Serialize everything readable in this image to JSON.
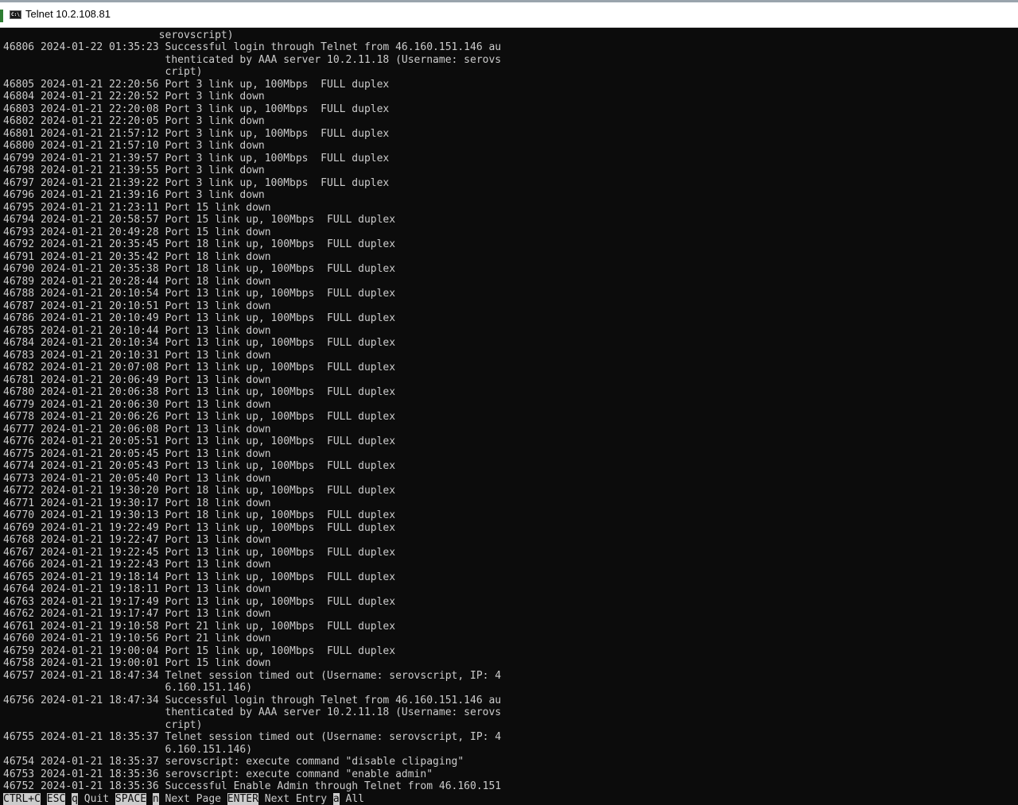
{
  "window": {
    "title": "Telnet 10.2.108.81",
    "icon": "console-icon",
    "icon_text": "C:\\"
  },
  "colors": {
    "terminal_bg": "#0c0c0c",
    "terminal_fg": "#cccccc",
    "titlebar_bg": "#ffffff"
  },
  "terminal": {
    "lines": [
      "                         serovscript)",
      "46806 2024-01-22 01:35:23 Successful login through Telnet from 46.160.151.146 au",
      "                          thenticated by AAA server 10.2.11.18 (Username: serovs",
      "                          cript)",
      "46805 2024-01-21 22:20:56 Port 3 link up, 100Mbps  FULL duplex",
      "46804 2024-01-21 22:20:52 Port 3 link down",
      "46803 2024-01-21 22:20:08 Port 3 link up, 100Mbps  FULL duplex",
      "46802 2024-01-21 22:20:05 Port 3 link down",
      "46801 2024-01-21 21:57:12 Port 3 link up, 100Mbps  FULL duplex",
      "46800 2024-01-21 21:57:10 Port 3 link down",
      "46799 2024-01-21 21:39:57 Port 3 link up, 100Mbps  FULL duplex",
      "46798 2024-01-21 21:39:55 Port 3 link down",
      "46797 2024-01-21 21:39:22 Port 3 link up, 100Mbps  FULL duplex",
      "46796 2024-01-21 21:39:16 Port 3 link down",
      "46795 2024-01-21 21:23:11 Port 15 link down",
      "46794 2024-01-21 20:58:57 Port 15 link up, 100Mbps  FULL duplex",
      "46793 2024-01-21 20:49:28 Port 15 link down",
      "46792 2024-01-21 20:35:45 Port 18 link up, 100Mbps  FULL duplex",
      "46791 2024-01-21 20:35:42 Port 18 link down",
      "46790 2024-01-21 20:35:38 Port 18 link up, 100Mbps  FULL duplex",
      "46789 2024-01-21 20:28:44 Port 18 link down",
      "46788 2024-01-21 20:10:54 Port 13 link up, 100Mbps  FULL duplex",
      "46787 2024-01-21 20:10:51 Port 13 link down",
      "46786 2024-01-21 20:10:49 Port 13 link up, 100Mbps  FULL duplex",
      "46785 2024-01-21 20:10:44 Port 13 link down",
      "46784 2024-01-21 20:10:34 Port 13 link up, 100Mbps  FULL duplex",
      "46783 2024-01-21 20:10:31 Port 13 link down",
      "46782 2024-01-21 20:07:08 Port 13 link up, 100Mbps  FULL duplex",
      "46781 2024-01-21 20:06:49 Port 13 link down",
      "46780 2024-01-21 20:06:38 Port 13 link up, 100Mbps  FULL duplex",
      "46779 2024-01-21 20:06:30 Port 13 link down",
      "46778 2024-01-21 20:06:26 Port 13 link up, 100Mbps  FULL duplex",
      "46777 2024-01-21 20:06:08 Port 13 link down",
      "46776 2024-01-21 20:05:51 Port 13 link up, 100Mbps  FULL duplex",
      "46775 2024-01-21 20:05:45 Port 13 link down",
      "46774 2024-01-21 20:05:43 Port 13 link up, 100Mbps  FULL duplex",
      "46773 2024-01-21 20:05:40 Port 13 link down",
      "46772 2024-01-21 19:30:20 Port 18 link up, 100Mbps  FULL duplex",
      "46771 2024-01-21 19:30:17 Port 18 link down",
      "46770 2024-01-21 19:30:13 Port 18 link up, 100Mbps  FULL duplex",
      "46769 2024-01-21 19:22:49 Port 13 link up, 100Mbps  FULL duplex",
      "46768 2024-01-21 19:22:47 Port 13 link down",
      "46767 2024-01-21 19:22:45 Port 13 link up, 100Mbps  FULL duplex",
      "46766 2024-01-21 19:22:43 Port 13 link down",
      "46765 2024-01-21 19:18:14 Port 13 link up, 100Mbps  FULL duplex",
      "46764 2024-01-21 19:18:11 Port 13 link down",
      "46763 2024-01-21 19:17:49 Port 13 link up, 100Mbps  FULL duplex",
      "46762 2024-01-21 19:17:47 Port 13 link down",
      "46761 2024-01-21 19:10:58 Port 21 link up, 100Mbps  FULL duplex",
      "46760 2024-01-21 19:10:56 Port 21 link down",
      "46759 2024-01-21 19:00:04 Port 15 link up, 100Mbps  FULL duplex",
      "46758 2024-01-21 19:00:01 Port 15 link down",
      "46757 2024-01-21 18:47:34 Telnet session timed out (Username: serovscript, IP: 4",
      "                          6.160.151.146)",
      "46756 2024-01-21 18:47:34 Successful login through Telnet from 46.160.151.146 au",
      "                          thenticated by AAA server 10.2.11.18 (Username: serovs",
      "                          cript)",
      "46755 2024-01-21 18:35:37 Telnet session timed out (Username: serovscript, IP: 4",
      "                          6.160.151.146)",
      "46754 2024-01-21 18:35:37 serovscript: execute command \"disable clipaging\"",
      "46753 2024-01-21 18:35:36 serovscript: execute command \"enable admin\"",
      "46752 2024-01-21 18:35:36 Successful Enable Admin through Telnet from 46.160.151"
    ]
  },
  "statusbar": {
    "items": [
      {
        "key": "CTRL+C",
        "text": " "
      },
      {
        "key": "ESC",
        "text": " "
      },
      {
        "key": "q",
        "text": " Quit "
      },
      {
        "key": "SPACE",
        "text": " "
      },
      {
        "key": "n",
        "text": " Next Page "
      },
      {
        "key": "ENTER",
        "text": " Next Entry "
      },
      {
        "key": "a",
        "text": " All"
      }
    ]
  }
}
